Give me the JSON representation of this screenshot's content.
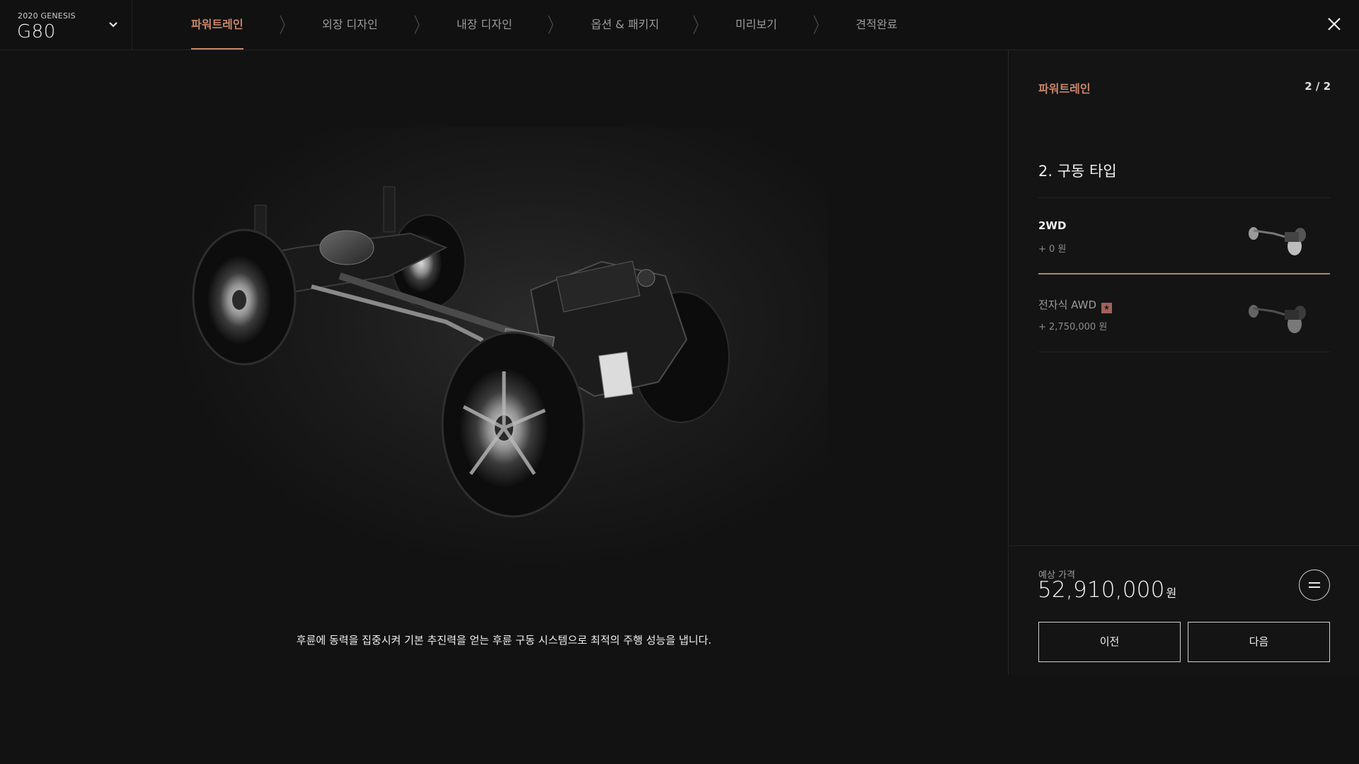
{
  "header": {
    "model_year": "2020 GENESIS",
    "model_name": "G80",
    "steps": [
      {
        "label": "파워트레인",
        "active": true
      },
      {
        "label": "외장 디자인",
        "active": false
      },
      {
        "label": "내장 디자인",
        "active": false
      },
      {
        "label": "옵션 & 패키지",
        "active": false
      },
      {
        "label": "미리보기",
        "active": false
      },
      {
        "label": "견적완료",
        "active": false
      }
    ]
  },
  "main": {
    "description": "후륜에 동력을 집중시켜 기본 추진력을 얻는 후륜 구동 시스템으로 최적의 주행 성능을 냅니다."
  },
  "panel": {
    "title": "파워트레인",
    "page": "2 / 2",
    "section_title": "2. 구동 타입",
    "options": [
      {
        "name": "2WD",
        "price": "+ 0 원",
        "selected": true
      },
      {
        "name": "전자식 AWD",
        "price": "+ 2,750,000 원",
        "selected": false,
        "badge": "★"
      }
    ],
    "price_label": "예상 가격",
    "price_value": "52,910,000",
    "price_unit": "원",
    "prev_label": "이전",
    "next_label": "다음"
  },
  "colors": {
    "accent": "#c8866a",
    "background": "#121212"
  }
}
